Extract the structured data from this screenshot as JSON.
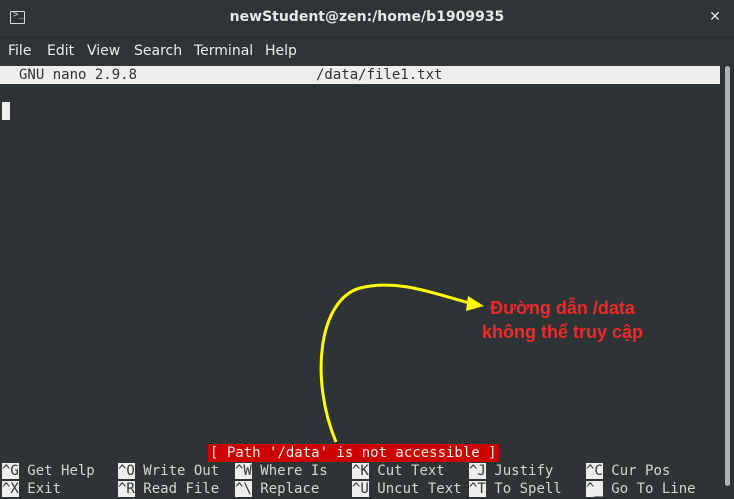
{
  "window": {
    "title": "newStudent@zen:/home/b1909935",
    "close_glyph": "✕",
    "icon_prompt": ">_"
  },
  "menu": [
    "File",
    "Edit",
    "View",
    "Search",
    "Terminal",
    "Help"
  ],
  "nano": {
    "version": "GNU nano 2.9.8",
    "filename": "/data/file1.txt",
    "status_message": "[ Path '/data' is not accessible ]"
  },
  "shortcuts_row1": [
    {
      "key": "^G",
      "label": "Get Help"
    },
    {
      "key": "^O",
      "label": "Write Out"
    },
    {
      "key": "^W",
      "label": "Where Is"
    },
    {
      "key": "^K",
      "label": "Cut Text"
    },
    {
      "key": "^J",
      "label": "Justify"
    },
    {
      "key": "^C",
      "label": "Cur Pos"
    }
  ],
  "shortcuts_row2": [
    {
      "key": "^X",
      "label": "Exit"
    },
    {
      "key": "^R",
      "label": "Read File"
    },
    {
      "key": "^\\",
      "label": "Replace"
    },
    {
      "key": "^U",
      "label": "Uncut Text"
    },
    {
      "key": "^T",
      "label": "To Spell"
    },
    {
      "key": "^_",
      "label": "Go To Line"
    }
  ],
  "annotation": {
    "line1": "Đường dẫn /data",
    "line2": "không thể truy cập",
    "color": "#ef2929",
    "arrow_color": "#ffff00"
  }
}
